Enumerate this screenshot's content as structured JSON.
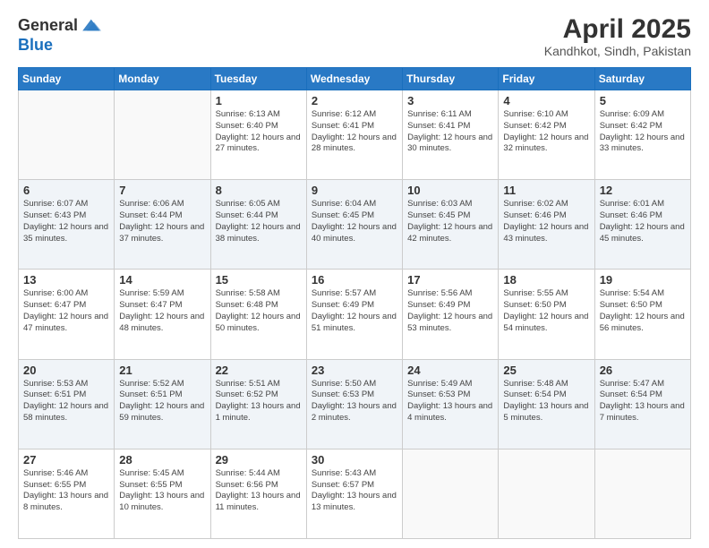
{
  "header": {
    "logo_line1": "General",
    "logo_line2": "Blue",
    "month": "April 2025",
    "location": "Kandhkot, Sindh, Pakistan"
  },
  "days_of_week": [
    "Sunday",
    "Monday",
    "Tuesday",
    "Wednesday",
    "Thursday",
    "Friday",
    "Saturday"
  ],
  "weeks": [
    {
      "shaded": false,
      "days": [
        {
          "num": "",
          "info": ""
        },
        {
          "num": "",
          "info": ""
        },
        {
          "num": "1",
          "info": "Sunrise: 6:13 AM\nSunset: 6:40 PM\nDaylight: 12 hours and 27 minutes."
        },
        {
          "num": "2",
          "info": "Sunrise: 6:12 AM\nSunset: 6:41 PM\nDaylight: 12 hours and 28 minutes."
        },
        {
          "num": "3",
          "info": "Sunrise: 6:11 AM\nSunset: 6:41 PM\nDaylight: 12 hours and 30 minutes."
        },
        {
          "num": "4",
          "info": "Sunrise: 6:10 AM\nSunset: 6:42 PM\nDaylight: 12 hours and 32 minutes."
        },
        {
          "num": "5",
          "info": "Sunrise: 6:09 AM\nSunset: 6:42 PM\nDaylight: 12 hours and 33 minutes."
        }
      ]
    },
    {
      "shaded": true,
      "days": [
        {
          "num": "6",
          "info": "Sunrise: 6:07 AM\nSunset: 6:43 PM\nDaylight: 12 hours and 35 minutes."
        },
        {
          "num": "7",
          "info": "Sunrise: 6:06 AM\nSunset: 6:44 PM\nDaylight: 12 hours and 37 minutes."
        },
        {
          "num": "8",
          "info": "Sunrise: 6:05 AM\nSunset: 6:44 PM\nDaylight: 12 hours and 38 minutes."
        },
        {
          "num": "9",
          "info": "Sunrise: 6:04 AM\nSunset: 6:45 PM\nDaylight: 12 hours and 40 minutes."
        },
        {
          "num": "10",
          "info": "Sunrise: 6:03 AM\nSunset: 6:45 PM\nDaylight: 12 hours and 42 minutes."
        },
        {
          "num": "11",
          "info": "Sunrise: 6:02 AM\nSunset: 6:46 PM\nDaylight: 12 hours and 43 minutes."
        },
        {
          "num": "12",
          "info": "Sunrise: 6:01 AM\nSunset: 6:46 PM\nDaylight: 12 hours and 45 minutes."
        }
      ]
    },
    {
      "shaded": false,
      "days": [
        {
          "num": "13",
          "info": "Sunrise: 6:00 AM\nSunset: 6:47 PM\nDaylight: 12 hours and 47 minutes."
        },
        {
          "num": "14",
          "info": "Sunrise: 5:59 AM\nSunset: 6:47 PM\nDaylight: 12 hours and 48 minutes."
        },
        {
          "num": "15",
          "info": "Sunrise: 5:58 AM\nSunset: 6:48 PM\nDaylight: 12 hours and 50 minutes."
        },
        {
          "num": "16",
          "info": "Sunrise: 5:57 AM\nSunset: 6:49 PM\nDaylight: 12 hours and 51 minutes."
        },
        {
          "num": "17",
          "info": "Sunrise: 5:56 AM\nSunset: 6:49 PM\nDaylight: 12 hours and 53 minutes."
        },
        {
          "num": "18",
          "info": "Sunrise: 5:55 AM\nSunset: 6:50 PM\nDaylight: 12 hours and 54 minutes."
        },
        {
          "num": "19",
          "info": "Sunrise: 5:54 AM\nSunset: 6:50 PM\nDaylight: 12 hours and 56 minutes."
        }
      ]
    },
    {
      "shaded": true,
      "days": [
        {
          "num": "20",
          "info": "Sunrise: 5:53 AM\nSunset: 6:51 PM\nDaylight: 12 hours and 58 minutes."
        },
        {
          "num": "21",
          "info": "Sunrise: 5:52 AM\nSunset: 6:51 PM\nDaylight: 12 hours and 59 minutes."
        },
        {
          "num": "22",
          "info": "Sunrise: 5:51 AM\nSunset: 6:52 PM\nDaylight: 13 hours and 1 minute."
        },
        {
          "num": "23",
          "info": "Sunrise: 5:50 AM\nSunset: 6:53 PM\nDaylight: 13 hours and 2 minutes."
        },
        {
          "num": "24",
          "info": "Sunrise: 5:49 AM\nSunset: 6:53 PM\nDaylight: 13 hours and 4 minutes."
        },
        {
          "num": "25",
          "info": "Sunrise: 5:48 AM\nSunset: 6:54 PM\nDaylight: 13 hours and 5 minutes."
        },
        {
          "num": "26",
          "info": "Sunrise: 5:47 AM\nSunset: 6:54 PM\nDaylight: 13 hours and 7 minutes."
        }
      ]
    },
    {
      "shaded": false,
      "days": [
        {
          "num": "27",
          "info": "Sunrise: 5:46 AM\nSunset: 6:55 PM\nDaylight: 13 hours and 8 minutes."
        },
        {
          "num": "28",
          "info": "Sunrise: 5:45 AM\nSunset: 6:55 PM\nDaylight: 13 hours and 10 minutes."
        },
        {
          "num": "29",
          "info": "Sunrise: 5:44 AM\nSunset: 6:56 PM\nDaylight: 13 hours and 11 minutes."
        },
        {
          "num": "30",
          "info": "Sunrise: 5:43 AM\nSunset: 6:57 PM\nDaylight: 13 hours and 13 minutes."
        },
        {
          "num": "",
          "info": ""
        },
        {
          "num": "",
          "info": ""
        },
        {
          "num": "",
          "info": ""
        }
      ]
    }
  ]
}
